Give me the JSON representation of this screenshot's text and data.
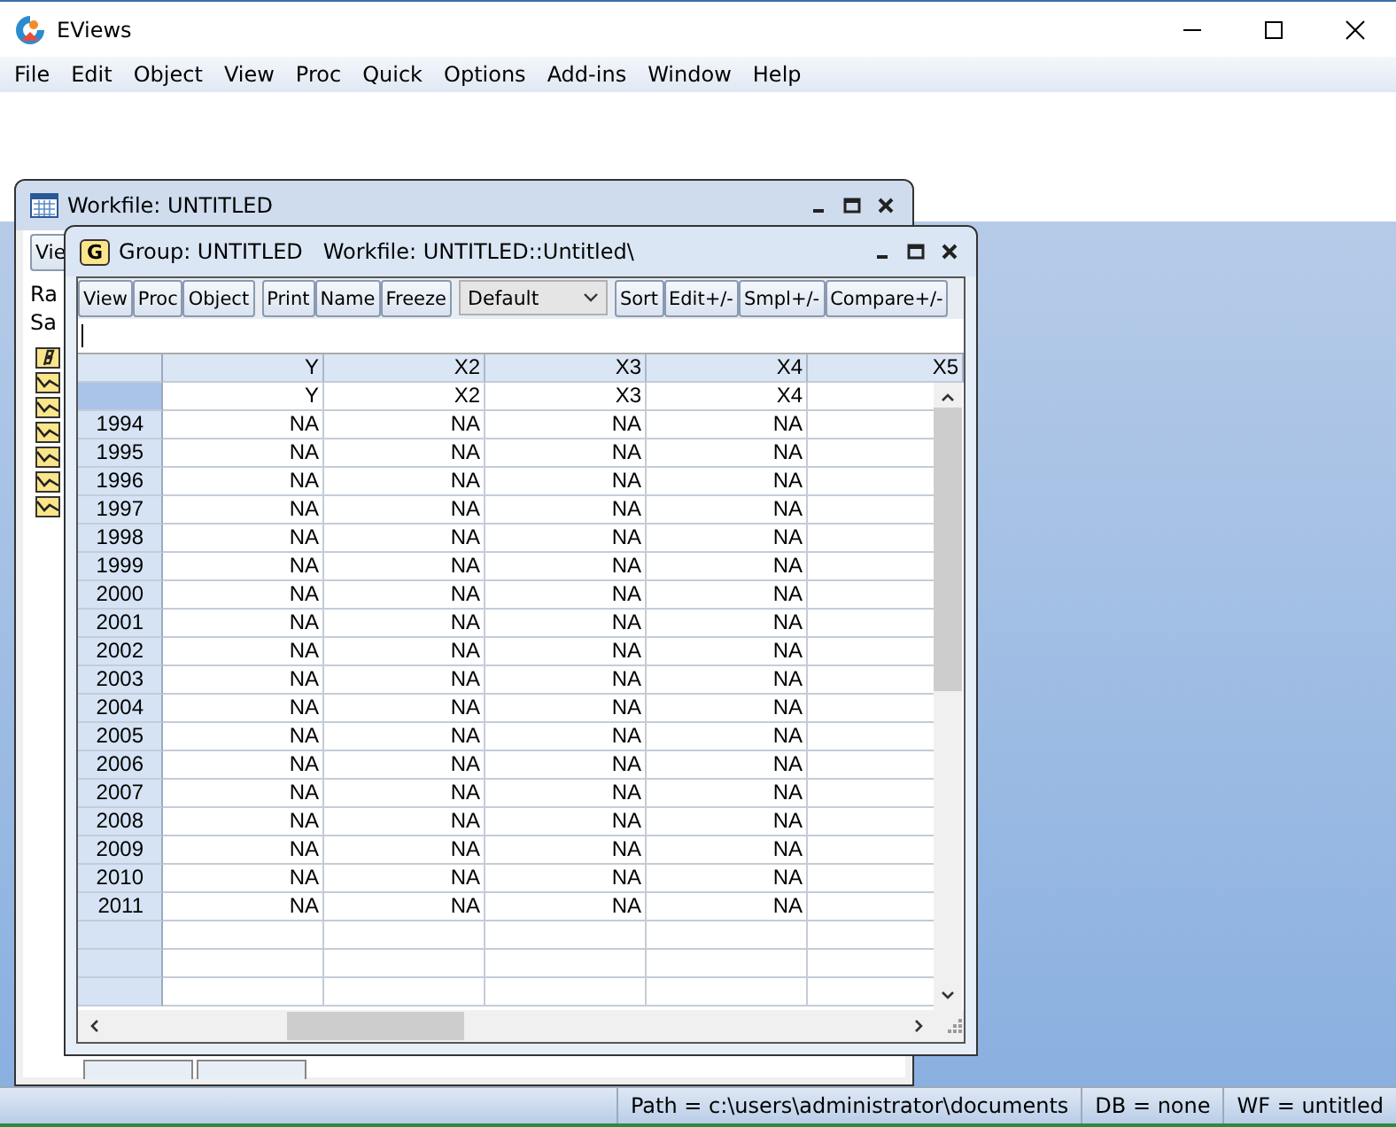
{
  "app": {
    "title": "EViews"
  },
  "menu": [
    "File",
    "Edit",
    "Object",
    "View",
    "Proc",
    "Quick",
    "Options",
    "Add-ins",
    "Window",
    "Help"
  ],
  "workfile_window": {
    "title": "Workfile: UNTITLED",
    "button": "Vie",
    "lines": [
      "Ra",
      "Sa"
    ],
    "objects": [
      {
        "kind": "coef"
      },
      {
        "kind": "series"
      },
      {
        "kind": "series"
      },
      {
        "kind": "series"
      },
      {
        "kind": "series"
      },
      {
        "kind": "series"
      },
      {
        "kind": "series"
      }
    ]
  },
  "group_window": {
    "badge": "G",
    "title": "Group: UNTITLED   Workfile: UNTITLED::Untitled\\",
    "toolbar": [
      [
        "View",
        "Proc",
        "Object"
      ],
      [
        "Print",
        "Name",
        "Freeze"
      ]
    ],
    "dropdown": "Default",
    "toolbar_right": [
      "Sort",
      "Edit+/-",
      "Smpl+/-",
      "Compare+/-"
    ],
    "columns": [
      "Y",
      "X2",
      "X3",
      "X4",
      "X5"
    ],
    "name_row": [
      "Y",
      "X2",
      "X3",
      "X4"
    ],
    "rows": [
      {
        "obs": "1994",
        "values": [
          "NA",
          "NA",
          "NA",
          "NA"
        ]
      },
      {
        "obs": "1995",
        "values": [
          "NA",
          "NA",
          "NA",
          "NA"
        ]
      },
      {
        "obs": "1996",
        "values": [
          "NA",
          "NA",
          "NA",
          "NA"
        ]
      },
      {
        "obs": "1997",
        "values": [
          "NA",
          "NA",
          "NA",
          "NA"
        ]
      },
      {
        "obs": "1998",
        "values": [
          "NA",
          "NA",
          "NA",
          "NA"
        ]
      },
      {
        "obs": "1999",
        "values": [
          "NA",
          "NA",
          "NA",
          "NA"
        ]
      },
      {
        "obs": "2000",
        "values": [
          "NA",
          "NA",
          "NA",
          "NA"
        ]
      },
      {
        "obs": "2001",
        "values": [
          "NA",
          "NA",
          "NA",
          "NA"
        ]
      },
      {
        "obs": "2002",
        "values": [
          "NA",
          "NA",
          "NA",
          "NA"
        ]
      },
      {
        "obs": "2003",
        "values": [
          "NA",
          "NA",
          "NA",
          "NA"
        ]
      },
      {
        "obs": "2004",
        "values": [
          "NA",
          "NA",
          "NA",
          "NA"
        ]
      },
      {
        "obs": "2005",
        "values": [
          "NA",
          "NA",
          "NA",
          "NA"
        ]
      },
      {
        "obs": "2006",
        "values": [
          "NA",
          "NA",
          "NA",
          "NA"
        ]
      },
      {
        "obs": "2007",
        "values": [
          "NA",
          "NA",
          "NA",
          "NA"
        ]
      },
      {
        "obs": "2008",
        "values": [
          "NA",
          "NA",
          "NA",
          "NA"
        ]
      },
      {
        "obs": "2009",
        "values": [
          "NA",
          "NA",
          "NA",
          "NA"
        ]
      },
      {
        "obs": "2010",
        "values": [
          "NA",
          "NA",
          "NA",
          "NA"
        ]
      },
      {
        "obs": "2011",
        "values": [
          "NA",
          "NA",
          "NA",
          "NA"
        ]
      }
    ]
  },
  "status_bar": [
    "Path = c:\\users\\administrator\\documents",
    "DB = none",
    "WF = untitled"
  ]
}
